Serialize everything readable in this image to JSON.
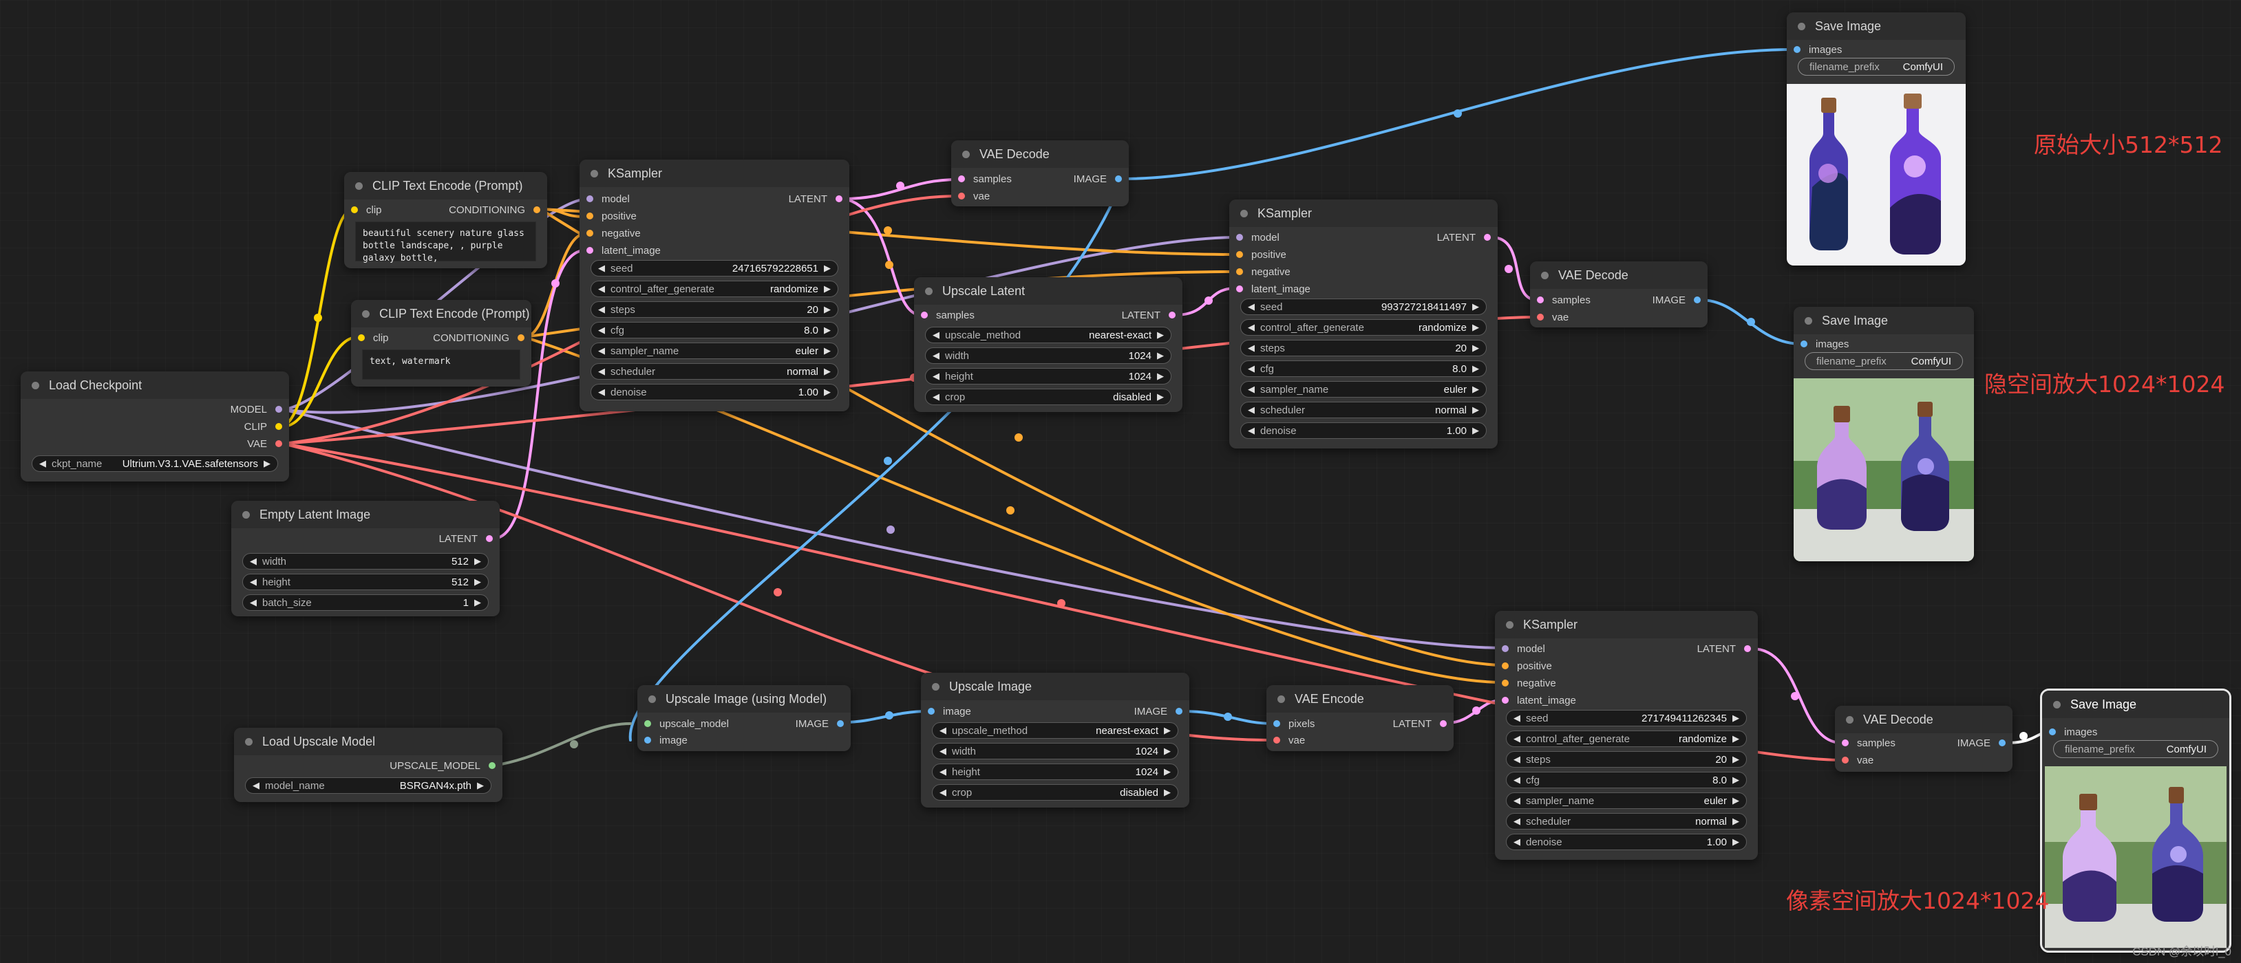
{
  "colors": {
    "model": "#b39ddb",
    "clip": "#ffd500",
    "vae": "#ff6e6e",
    "conditioning": "#ffa931",
    "latent": "#ff9cf9",
    "image": "#64b5f6",
    "upscale_model": "#8bd98b"
  },
  "nodes": {
    "load_checkpoint": {
      "title": "Load Checkpoint",
      "outputs": [
        "MODEL",
        "CLIP",
        "VAE"
      ],
      "ckpt_label": "ckpt_name",
      "ckpt_value": "Ultrium.V3.1.VAE.safetensors"
    },
    "clip1": {
      "title": "CLIP Text Encode (Prompt)",
      "input": "clip",
      "output": "CONDITIONING",
      "text": "beautiful scenery nature glass bottle landscape, , purple galaxy bottle,"
    },
    "clip2": {
      "title": "CLIP Text Encode (Prompt)",
      "input": "clip",
      "output": "CONDITIONING",
      "text": "text, watermark"
    },
    "empty_latent": {
      "title": "Empty Latent Image",
      "output": "LATENT",
      "widgets": [
        {
          "label": "width",
          "value": "512"
        },
        {
          "label": "height",
          "value": "512"
        },
        {
          "label": "batch_size",
          "value": "1"
        }
      ]
    },
    "ksampler1": {
      "title": "KSampler",
      "inputs": [
        "model",
        "positive",
        "negative",
        "latent_image"
      ],
      "output": "LATENT",
      "widgets": [
        {
          "label": "seed",
          "value": "247165792228651"
        },
        {
          "label": "control_after_generate",
          "value": "randomize"
        },
        {
          "label": "steps",
          "value": "20"
        },
        {
          "label": "cfg",
          "value": "8.0"
        },
        {
          "label": "sampler_name",
          "value": "euler"
        },
        {
          "label": "scheduler",
          "value": "normal"
        },
        {
          "label": "denoise",
          "value": "1.00"
        }
      ]
    },
    "vae_decode1": {
      "title": "VAE Decode",
      "inputs": [
        "samples",
        "vae"
      ],
      "output": "IMAGE"
    },
    "save1": {
      "title": "Save Image",
      "input": "images",
      "prefix_label": "filename_prefix",
      "prefix_value": "ComfyUI"
    },
    "upscale_latent": {
      "title": "Upscale Latent",
      "input": "samples",
      "output": "LATENT",
      "widgets": [
        {
          "label": "upscale_method",
          "value": "nearest-exact"
        },
        {
          "label": "width",
          "value": "1024"
        },
        {
          "label": "height",
          "value": "1024"
        },
        {
          "label": "crop",
          "value": "disabled"
        }
      ]
    },
    "ksampler2": {
      "title": "KSampler",
      "inputs": [
        "model",
        "positive",
        "negative",
        "latent_image"
      ],
      "output": "LATENT",
      "widgets": [
        {
          "label": "seed",
          "value": "993727218411497"
        },
        {
          "label": "control_after_generate",
          "value": "randomize"
        },
        {
          "label": "steps",
          "value": "20"
        },
        {
          "label": "cfg",
          "value": "8.0"
        },
        {
          "label": "sampler_name",
          "value": "euler"
        },
        {
          "label": "scheduler",
          "value": "normal"
        },
        {
          "label": "denoise",
          "value": "1.00"
        }
      ]
    },
    "vae_decode2": {
      "title": "VAE Decode",
      "inputs": [
        "samples",
        "vae"
      ],
      "output": "IMAGE"
    },
    "save2": {
      "title": "Save Image",
      "input": "images",
      "prefix_label": "filename_prefix",
      "prefix_value": "ComfyUI"
    },
    "load_upscale_model": {
      "title": "Load Upscale Model",
      "output": "UPSCALE_MODEL",
      "model_label": "model_name",
      "model_value": "BSRGAN4x.pth"
    },
    "upscale_with_model": {
      "title": "Upscale Image (using Model)",
      "inputs": [
        "upscale_model",
        "image"
      ],
      "output": "IMAGE"
    },
    "upscale_image": {
      "title": "Upscale Image",
      "input": "image",
      "output": "IMAGE",
      "widgets": [
        {
          "label": "upscale_method",
          "value": "nearest-exact"
        },
        {
          "label": "width",
          "value": "1024"
        },
        {
          "label": "height",
          "value": "1024"
        },
        {
          "label": "crop",
          "value": "disabled"
        }
      ]
    },
    "vae_encode": {
      "title": "VAE Encode",
      "inputs": [
        "pixels",
        "vae"
      ],
      "output": "LATENT"
    },
    "ksampler3": {
      "title": "KSampler",
      "inputs": [
        "model",
        "positive",
        "negative",
        "latent_image"
      ],
      "output": "LATENT",
      "widgets": [
        {
          "label": "seed",
          "value": "271749411262345"
        },
        {
          "label": "control_after_generate",
          "value": "randomize"
        },
        {
          "label": "steps",
          "value": "20"
        },
        {
          "label": "cfg",
          "value": "8.0"
        },
        {
          "label": "sampler_name",
          "value": "euler"
        },
        {
          "label": "scheduler",
          "value": "normal"
        },
        {
          "label": "denoise",
          "value": "1.00"
        }
      ]
    },
    "vae_decode3": {
      "title": "VAE Decode",
      "inputs": [
        "samples",
        "vae"
      ],
      "output": "IMAGE"
    },
    "save3": {
      "title": "Save Image",
      "input": "images",
      "prefix_label": "filename_prefix",
      "prefix_value": "ComfyUI"
    }
  },
  "annotations": {
    "original": "原始大小512*512",
    "latent": "隐空间放大1024*1024",
    "pixel": "像素空间放大1024*1024"
  },
  "watermark": "CSDN @余以时l_0"
}
